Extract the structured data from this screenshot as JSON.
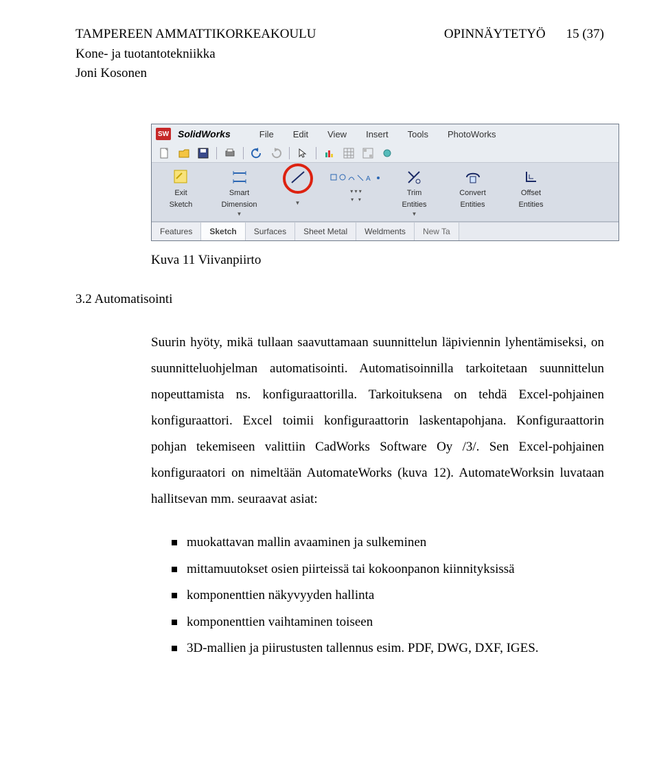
{
  "header": {
    "institution": "TAMPEREEN AMMATTIKORKEAKOULU",
    "programme": "Kone- ja tuotantotekniikka",
    "author": "Joni Kosonen",
    "doc_type": "OPINNÄYTETYÖ",
    "page": "15 (37)"
  },
  "solidworks": {
    "logo": "SW",
    "brand": "SolidWorks",
    "menus": [
      "File",
      "Edit",
      "View",
      "Insert",
      "Tools",
      "PhotoWorks"
    ],
    "big_buttons": [
      {
        "label1": "Exit",
        "label2": "Sketch"
      },
      {
        "label1": "Smart",
        "label2": "Dimension"
      },
      {
        "label1": "",
        "label2": ""
      },
      {
        "label1": "",
        "label2": ""
      },
      {
        "label1": "Trim",
        "label2": "Entities"
      },
      {
        "label1": "Convert",
        "label2": "Entities"
      },
      {
        "label1": "Offset",
        "label2": "Entities"
      }
    ],
    "tabs": [
      "Features",
      "Sketch",
      "Surfaces",
      "Sheet Metal",
      "Weldments",
      "New Ta"
    ],
    "active_tab": "Sketch"
  },
  "caption": "Kuva 11 Viivanpiirto",
  "section_heading": "3.2 Automatisointi",
  "paragraph": "Suurin hyöty, mikä tullaan saavuttamaan suunnittelun läpiviennin lyhentämiseksi, on suunnitteluohjelman automatisointi. Automatisoinnilla tarkoitetaan suunnittelun nopeuttamista ns. konfiguraattorilla. Tarkoituksena on tehdä Excel-pohjainen konfiguraattori. Excel toimii konfiguraattorin laskentapohjana. Konfiguraattorin pohjan tekemiseen valittiin CadWorks  Software Oy /3/. Sen Excel-pohjainen konfiguraatori on nimeltään AutomateWorks (kuva 12). AutomateWorksin luvataan hallitsevan mm. seuraavat asiat:",
  "bullets": [
    "muokattavan mallin avaaminen ja sulkeminen",
    "mittamuutokset osien piirteissä tai kokoonpanon kiinnityksissä",
    "komponenttien näkyvyyden hallinta",
    "komponenttien vaihtaminen toiseen",
    "3D-mallien ja piirustusten tallennus esim. PDF, DWG, DXF, IGES."
  ]
}
